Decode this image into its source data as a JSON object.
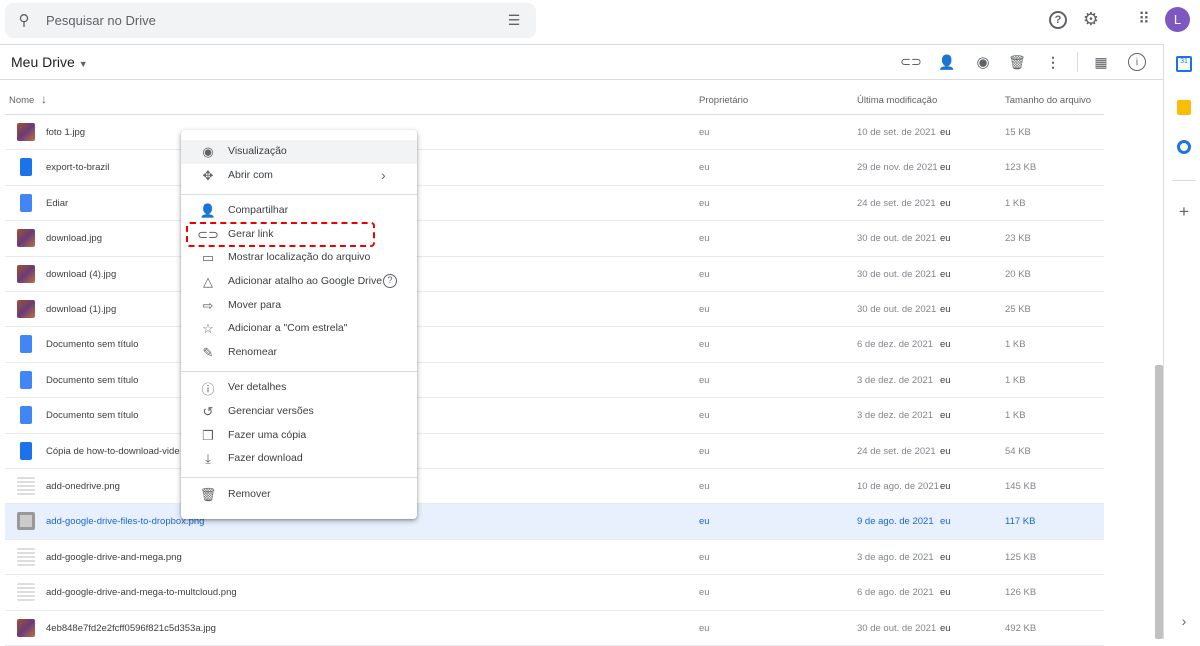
{
  "search": {
    "placeholder": "Pesquisar no Drive"
  },
  "header": {
    "avatar_letter": "L",
    "title": "Meu Drive"
  },
  "columns": {
    "name": "Nome",
    "owner": "Proprietário",
    "modified": "Última modificação",
    "size": "Tamanho do arquivo"
  },
  "files": [
    {
      "name": "foto 1.jpg",
      "type": "image",
      "owner": "eu",
      "modified": "10 de set. de 2021",
      "by": "eu",
      "size": "15 KB"
    },
    {
      "name": "export-to-brazil",
      "type": "file",
      "owner": "eu",
      "modified": "29 de nov. de 2021",
      "by": "eu",
      "size": "123 KB"
    },
    {
      "name": "Ediar",
      "type": "doc",
      "owner": "eu",
      "modified": "24 de set. de 2021",
      "by": "eu",
      "size": "1 KB"
    },
    {
      "name": "download.jpg",
      "type": "image",
      "owner": "eu",
      "modified": "30 de out. de 2021",
      "by": "eu",
      "size": "23 KB"
    },
    {
      "name": "download (4).jpg",
      "type": "image",
      "owner": "eu",
      "modified": "30 de out. de 2021",
      "by": "eu",
      "size": "20 KB"
    },
    {
      "name": "download (1).jpg",
      "type": "image",
      "owner": "eu",
      "modified": "30 de out. de 2021",
      "by": "eu",
      "size": "25 KB"
    },
    {
      "name": "Documento sem título",
      "type": "doc",
      "owner": "eu",
      "modified": "6 de dez. de 2021",
      "by": "eu",
      "size": "1 KB"
    },
    {
      "name": "Documento sem título",
      "type": "doc",
      "owner": "eu",
      "modified": "3 de dez. de 2021",
      "by": "eu",
      "size": "1 KB"
    },
    {
      "name": "Documento sem título",
      "type": "doc",
      "owner": "eu",
      "modified": "3 de dez. de 2021",
      "by": "eu",
      "size": "1 KB"
    },
    {
      "name": "Cópia de how-to-download-vide",
      "type": "file",
      "owner": "eu",
      "modified": "24 de set. de 2021",
      "by": "eu",
      "size": "54 KB"
    },
    {
      "name": "add-onedrive.png",
      "type": "png",
      "owner": "eu",
      "modified": "10 de ago. de 2021",
      "by": "eu",
      "size": "145 KB"
    },
    {
      "name": "add-google-drive-files-to-dropbox.png",
      "type": "png",
      "owner": "eu",
      "modified": "9 de ago. de 2021",
      "by": "eu",
      "size": "117 KB",
      "selected": true
    },
    {
      "name": "add-google-drive-and-mega.png",
      "type": "png",
      "owner": "eu",
      "modified": "3 de ago. de 2021",
      "by": "eu",
      "size": "125 KB"
    },
    {
      "name": "add-google-drive-and-mega-to-multcloud.png",
      "type": "png",
      "owner": "eu",
      "modified": "6 de ago. de 2021",
      "by": "eu",
      "size": "126 KB"
    },
    {
      "name": "4eb848e7fd2e2fcff0596f821c5d353a.jpg",
      "type": "image",
      "owner": "eu",
      "modified": "30 de out. de 2021",
      "by": "eu",
      "size": "492 KB"
    }
  ],
  "menu": [
    {
      "label": "Visualização",
      "icon": "eye-icon",
      "glyph": "◉"
    },
    {
      "label": "Abrir com",
      "icon": "move-arrows-icon",
      "glyph": "✥",
      "submenu": "›"
    },
    {
      "label": "Compartilhar",
      "icon": "add-person-icon",
      "glyph": "👤"
    },
    {
      "label": "Gerar link",
      "icon": "link-icon",
      "glyph": "⊂⊃"
    },
    {
      "label": "Mostrar localização do arquivo",
      "icon": "folder-icon",
      "glyph": "▭"
    },
    {
      "label": "Adicionar atalho ao Google Drive",
      "icon": "drive-shortcut-icon",
      "glyph": "△",
      "help": "?"
    },
    {
      "label": "Mover para",
      "icon": "move-folder-icon",
      "glyph": "⇨"
    },
    {
      "label": "Adicionar a \"Com estrela\"",
      "icon": "star-icon",
      "glyph": "☆"
    },
    {
      "label": "Renomear",
      "icon": "pencil-icon",
      "glyph": "✎"
    },
    {
      "label": "Ver detalhes",
      "icon": "info-icon",
      "glyph": "ⓘ"
    },
    {
      "label": "Gerenciar versões",
      "icon": "history-icon",
      "glyph": "↺"
    },
    {
      "label": "Fazer uma cópia",
      "icon": "copy-icon",
      "glyph": "❐"
    },
    {
      "label": "Fazer download",
      "icon": "download-icon",
      "glyph": "⤓"
    },
    {
      "label": "Remover",
      "icon": "trash-icon",
      "glyph": "🗑"
    }
  ],
  "colors": {
    "accent": "#1a73e8",
    "selected_row": "#e8f0fe",
    "avatar": "#7e57c2",
    "highlight": "#ee0000"
  }
}
